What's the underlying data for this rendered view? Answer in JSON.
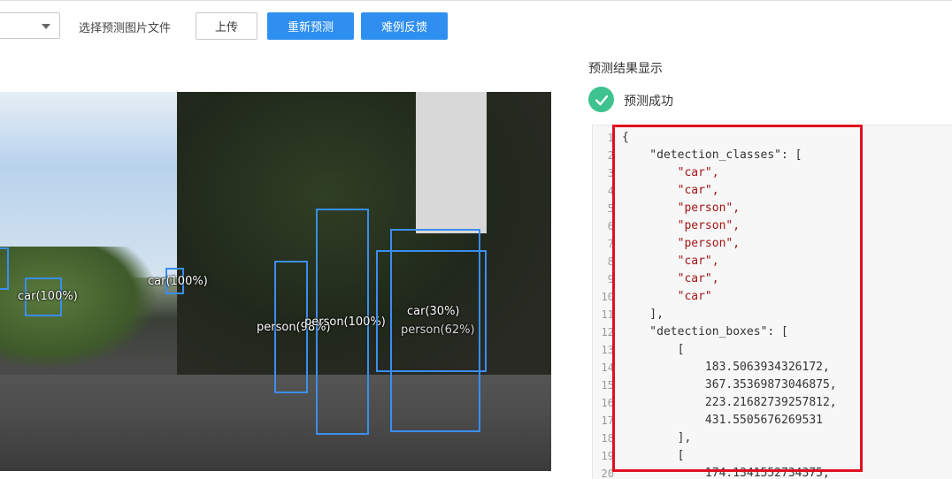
{
  "toolbar": {
    "hint": "选择预测图片文件",
    "upload_label": "上传",
    "repredict_label": "重新预测",
    "feedback_label": "难例反馈"
  },
  "image": {
    "detections": [
      {
        "label": "car(100%)"
      },
      {
        "label": "car(100%)"
      },
      {
        "label": "person(98%)"
      },
      {
        "label": "person(100%)"
      },
      {
        "label": "car(30%)"
      },
      {
        "label": "person(62%)"
      }
    ]
  },
  "result": {
    "title": "预测结果显示",
    "status": "预测成功",
    "status_color": "#3ec28f",
    "line_numbers": [
      "1",
      "2",
      "3",
      "4",
      "5",
      "6",
      "7",
      "8",
      "9",
      "10",
      "11",
      "12",
      "13",
      "14",
      "15",
      "16",
      "17",
      "18",
      "19",
      "20"
    ],
    "lines": [
      "{",
      "    \"detection_classes\": [",
      "        \"car\",",
      "        \"car\",",
      "        \"person\",",
      "        \"person\",",
      "        \"person\",",
      "        \"car\",",
      "        \"car\",",
      "        \"car\"",
      "    ],",
      "    \"detection_boxes\": [",
      "        [",
      "            183.5063934326172,",
      "            367.35369873046875,",
      "            223.21682739257812,",
      "            431.5505676269531",
      "        ],",
      "        [",
      "            174.1341552734375,"
    ]
  }
}
